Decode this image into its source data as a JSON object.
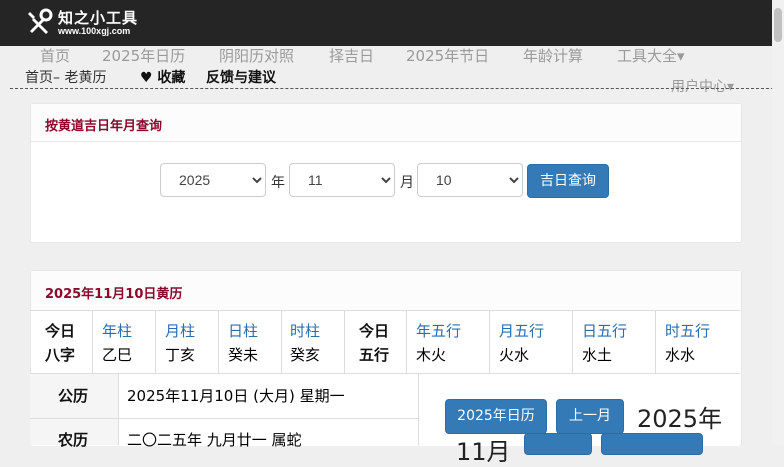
{
  "logo": {
    "title": "知之小工具",
    "subtitle": "www.100xgj.com"
  },
  "nav": {
    "items": [
      "首页",
      "2025年日历",
      "阴阳历对照",
      "择吉日",
      "2025年节日",
      "年龄计算",
      "工具大全▾"
    ],
    "breadcrumb": "首页– 老黄历",
    "favorite": "♥ 收藏",
    "feedback": "反馈与建议",
    "user_center": "用户中心▾"
  },
  "query": {
    "title": "按黄道吉日年月查询",
    "year_value": "2025",
    "month_value": "11",
    "day_value": "10",
    "year_unit": "年",
    "month_unit": "月",
    "button": "吉日查询"
  },
  "almanac": {
    "title": "2025年11月10日黄历",
    "bazi_label_1": "今日",
    "bazi_label_2": "八字",
    "pillars": [
      {
        "name": "年柱",
        "value": "乙巳"
      },
      {
        "name": "月柱",
        "value": "丁亥"
      },
      {
        "name": "日柱",
        "value": "癸未"
      },
      {
        "name": "时柱",
        "value": "癸亥"
      }
    ],
    "wuxing_label_1": "今日",
    "wuxing_label_2": "五行",
    "wuxing": [
      {
        "name": "年五行",
        "value": "木火"
      },
      {
        "name": "月五行",
        "value": "火水"
      },
      {
        "name": "日五行",
        "value": "水土"
      },
      {
        "name": "时五行",
        "value": "水水"
      }
    ],
    "solar_label": "公历",
    "solar_value": "2025年11月10日 (大月) 星期一",
    "lunar_label": "农历",
    "lunar_value": "二〇二五年 九月廿一 属蛇"
  },
  "calendar": {
    "btn_year": "2025年日历",
    "btn_prev": "上一月",
    "heading": "2025年",
    "heading2": "11月"
  }
}
